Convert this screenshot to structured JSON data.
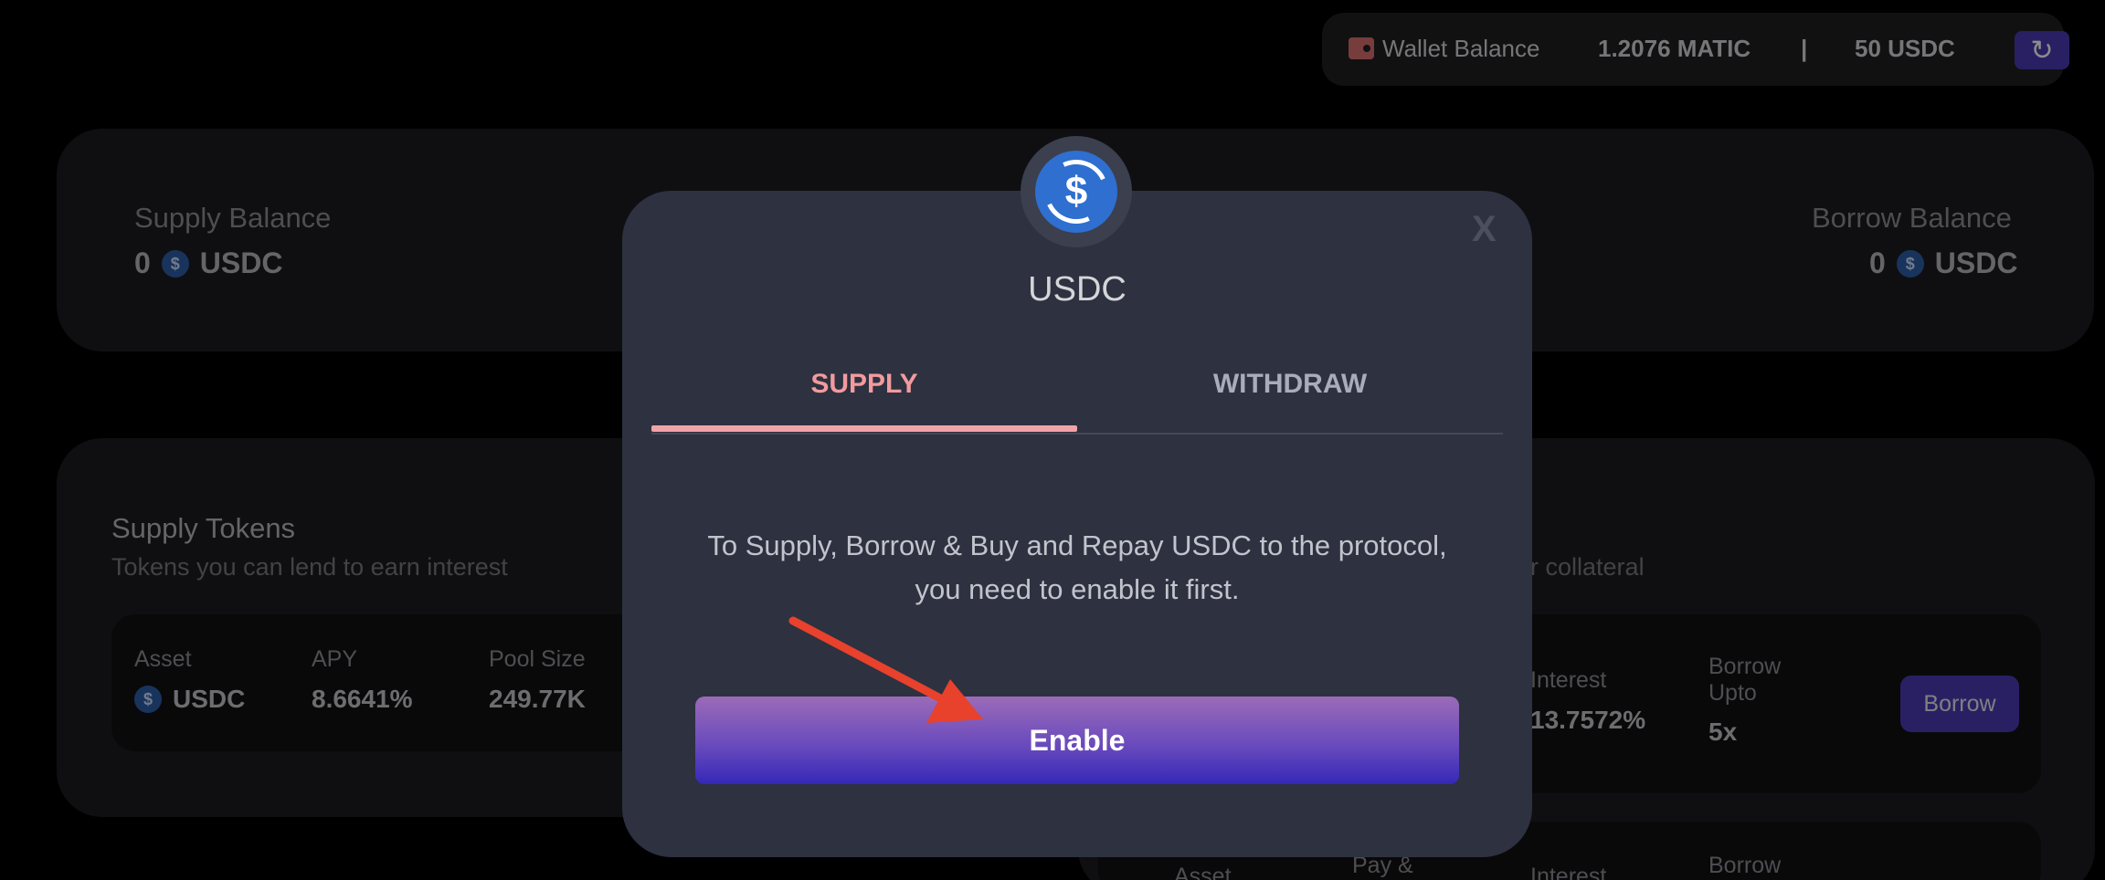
{
  "wallet": {
    "label": "Wallet Balance",
    "matic": "1.2076 MATIC",
    "separator": "|",
    "usdc": "50 USDC",
    "refresh_icon": "↻"
  },
  "summary": {
    "supply_label": "Supply Balance",
    "supply_value": "0",
    "supply_token": "USDC",
    "borrow_label": "Borrow Balance",
    "borrow_value": "0",
    "borrow_token": "USDC"
  },
  "supply_section": {
    "title": "Supply Tokens",
    "subtitle": "Tokens you can lend to earn interest",
    "headers": {
      "asset": "Asset",
      "apy": "APY",
      "pool_size": "Pool Size"
    },
    "row": {
      "asset": "USDC",
      "apy": "8.6641%",
      "pool_size": "249.77K"
    }
  },
  "borrow_section": {
    "subtitle_fragment": "er collateral",
    "row1": {
      "interest_label": "Interest",
      "interest_value": "13.7572%",
      "upto_label_1": "Borrow",
      "upto_label_2": "Upto",
      "upto_value": "5x",
      "button": "Borrow"
    },
    "row2": {
      "asset_label": "Asset",
      "pay_label": "Pay &",
      "interest_label": "Interest",
      "borrow_label": "Borrow"
    }
  },
  "modal": {
    "coin_icon": "$",
    "close": "X",
    "title": "USDC",
    "tabs": [
      "SUPPLY",
      "WITHDRAW"
    ],
    "message": "To Supply, Borrow & Buy and Repay USDC to the protocol, you need to enable it first.",
    "enable_button": "Enable"
  },
  "colors": {
    "accent_tab": "#f29a9e",
    "button_gradient_top": "#9b6bb8",
    "button_gradient_bottom": "#3528b8",
    "arrow": "#e8412c"
  }
}
